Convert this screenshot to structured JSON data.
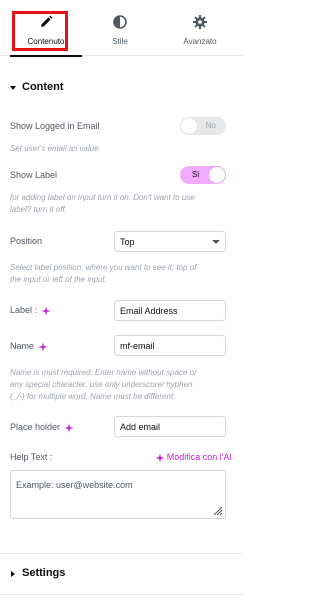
{
  "tabs": [
    {
      "label": "Contenuto",
      "icon": "pencil-icon",
      "active": true
    },
    {
      "label": "Stile",
      "icon": "half-circle-icon",
      "active": false
    },
    {
      "label": "Avanzato",
      "icon": "gear-icon",
      "active": false
    }
  ],
  "content_section": {
    "title": "Content",
    "show_logged_email": {
      "label": "Show Logged in Email",
      "toggle_text": "No",
      "enabled": false,
      "description": "Set user's email as value"
    },
    "show_label": {
      "label": "Show Label",
      "toggle_text": "Si",
      "enabled": true,
      "description_line1": "for adding label on input turn it on. Don't want to use",
      "description_line2": "label? turn it off."
    },
    "position": {
      "label": "Position",
      "value": "Top",
      "description_line1": "Select label position. where you want to see it. top of",
      "description_line2": "the input or left of the input."
    },
    "label_field": {
      "label": "Label :",
      "value": "Email Address"
    },
    "name_field": {
      "label": "Name",
      "value": "mf-email",
      "description_line1": "Name is must required. Enter name without space or",
      "description_line2": "any special character. use only underscore/ hyphen",
      "description_line3": "(_/-) for multiple word. Name must be different."
    },
    "placeholder_field": {
      "label": "Place holder",
      "value": "Add email"
    },
    "help_text": {
      "label": "Help Text :",
      "ai_link": "Modifica con l'AI",
      "value": "Example: user@website.com"
    }
  },
  "settings_section": {
    "title": "Settings"
  },
  "colors": {
    "accent": "#c026d3",
    "toggle_on": "#f0abfc",
    "highlight_box": "#e8121b"
  }
}
